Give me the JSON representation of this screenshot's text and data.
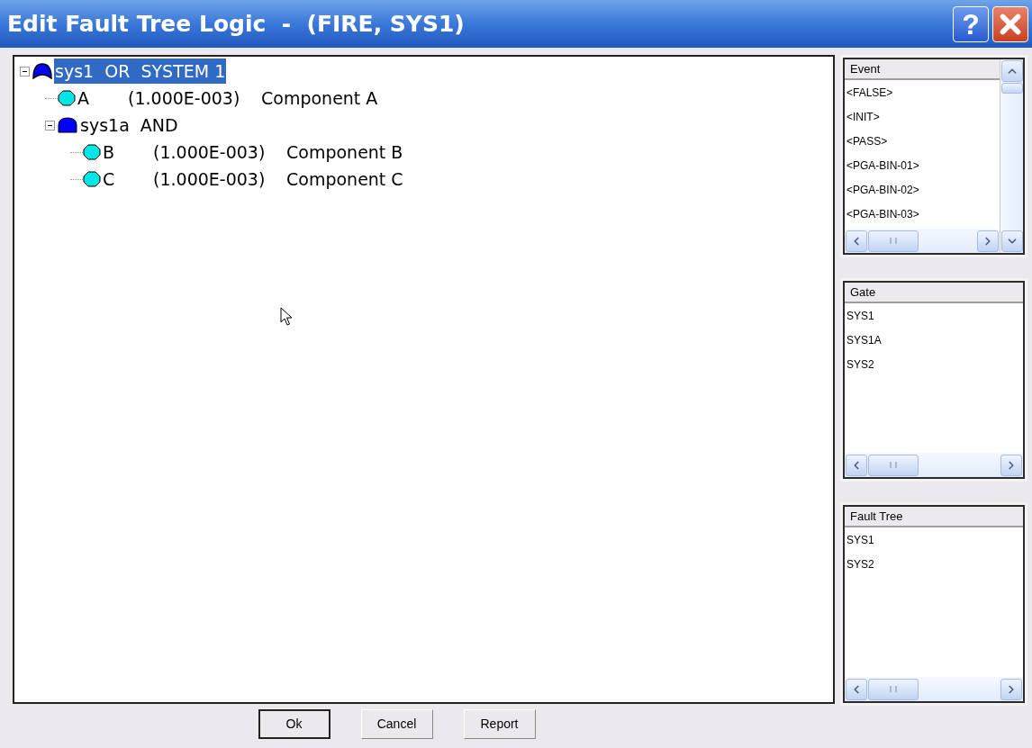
{
  "window": {
    "title": "Edit Fault Tree Logic  -  (FIRE, SYS1)",
    "help_button": "?"
  },
  "tree": [
    {
      "kind": "or",
      "label": "sys1  OR  SYSTEM 1",
      "selected": true,
      "expanded": true,
      "children": [
        {
          "kind": "event",
          "id": "A",
          "probability": "(1.000E-003)",
          "description": "Component A",
          "selected": false
        },
        {
          "kind": "and",
          "label": "sys1a  AND",
          "selected": false,
          "expanded": true,
          "children": [
            {
              "kind": "event",
              "id": "B",
              "probability": "(1.000E-003)",
              "description": "Component B",
              "selected": false
            },
            {
              "kind": "event",
              "id": "C",
              "probability": "(1.000E-003)",
              "description": "Component C",
              "selected": false
            }
          ]
        }
      ]
    }
  ],
  "lists": [
    {
      "header": "Event",
      "vertical_scrollbar": true,
      "items": [
        "<FALSE>",
        "<INIT>",
        "<PASS>",
        "<PGA-BIN-01>",
        "<PGA-BIN-02>",
        "<PGA-BIN-03>"
      ]
    },
    {
      "header": "Gate",
      "vertical_scrollbar": false,
      "items": [
        "SYS1",
        "SYS1A",
        "SYS2"
      ]
    },
    {
      "header": "Fault Tree",
      "vertical_scrollbar": false,
      "items": [
        "SYS1",
        "SYS2"
      ]
    }
  ],
  "buttons": [
    {
      "label": "Ok",
      "default": true
    },
    {
      "label": "Cancel",
      "default": false
    },
    {
      "label": "Report",
      "default": false
    }
  ]
}
